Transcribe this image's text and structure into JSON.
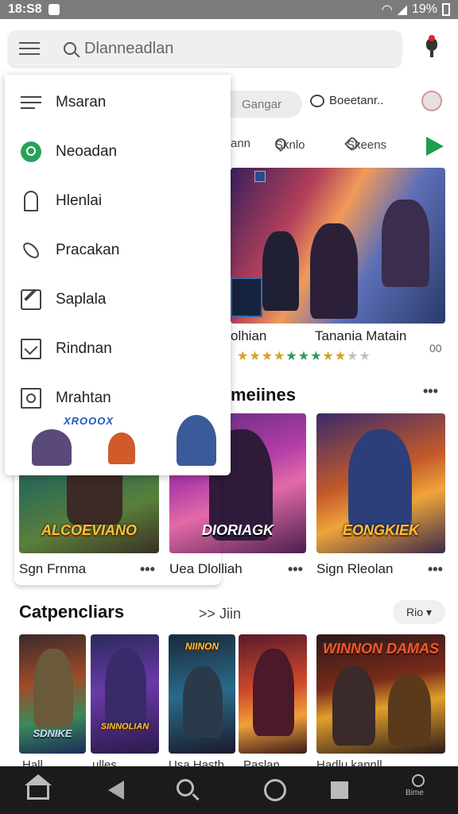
{
  "status_bar": {
    "time": "18:S8",
    "battery": "19%"
  },
  "search": {
    "placeholder": "Dlanneadlan"
  },
  "top_chips": {
    "pill": "Gangar",
    "message": "Boeetanr.."
  },
  "filters": {
    "f1": "ann",
    "f2": "Sknlo",
    "f3": "Skeens"
  },
  "featured": {
    "caption_left": "olhian",
    "caption_right": "Tanania Matain",
    "stars": "★★★★★★★★★★★",
    "more": "00"
  },
  "section1": {
    "title": "meiines",
    "more": "•••"
  },
  "row1": [
    {
      "logo": "ALCOEVIANO",
      "label": "Sgn Frnma",
      "more": "•••"
    },
    {
      "logo": "DIORIAGK",
      "label": "Uea Dlolliah",
      "more": "•••"
    },
    {
      "logo": "EONGKIEK",
      "label": "Sign Rleolan",
      "more": "•••"
    }
  ],
  "section2": {
    "title": "Catpencliars",
    "see_all": ">> Jiin",
    "sort": "Rio"
  },
  "row2": [
    {
      "logo": "SDNIKE"
    },
    {
      "logo": "SINNOLIAN"
    },
    {
      "logo": "NIINON"
    },
    {
      "logo": ""
    },
    {
      "logo": "WINNON DAMAS"
    }
  ],
  "row2_labels": [
    "Hall",
    "ulles",
    "Usa Hasth",
    "Paslan",
    "Hadlu kannll"
  ],
  "drawer": {
    "items": [
      {
        "label": "Msaran",
        "icon": "menu-lines-icon"
      },
      {
        "label": "Neoadan",
        "icon": "green-circle-icon"
      },
      {
        "label": "Hlenlai",
        "icon": "bookmark-icon"
      },
      {
        "label": "Pracakan",
        "icon": "link-icon"
      },
      {
        "label": "Saplala",
        "icon": "edit-icon"
      },
      {
        "label": "Rindnan",
        "icon": "checkbox-icon"
      },
      {
        "label": "Mrahtan",
        "icon": "photo-icon"
      }
    ],
    "banner": "XROOOX"
  },
  "navbar": {
    "profile_label": "Bime"
  },
  "colors": {
    "accent_green": "#27a45a",
    "share_green": "#1e9d4b",
    "nav_bg": "#1b1b1b"
  }
}
